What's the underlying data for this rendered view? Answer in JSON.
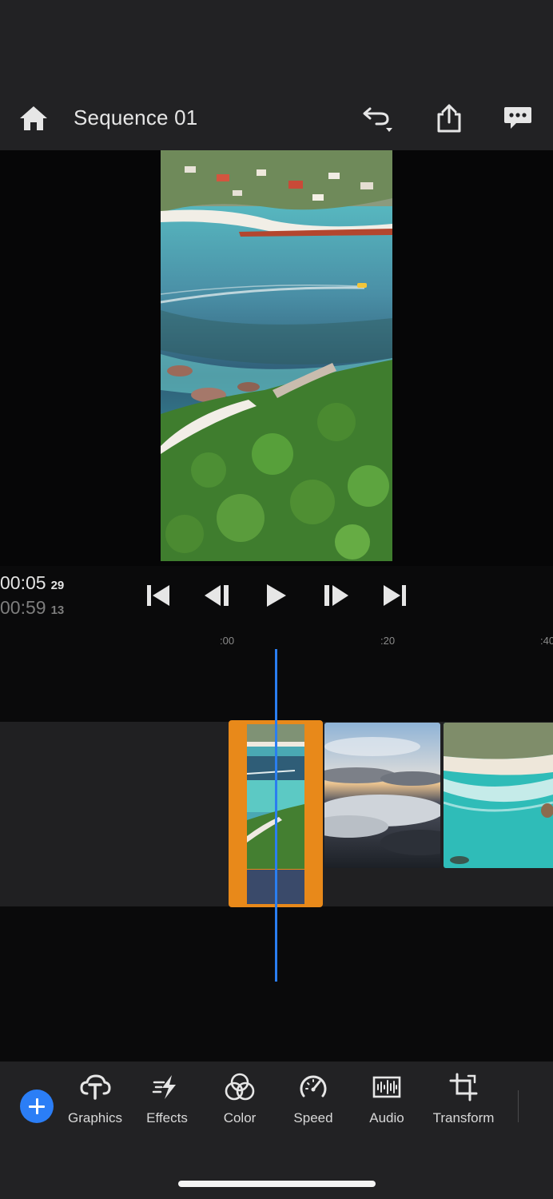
{
  "header": {
    "title": "Sequence 01",
    "icons": [
      "home-icon",
      "undo-icon",
      "share-icon",
      "comments-icon"
    ]
  },
  "playback": {
    "current_time": "00:05",
    "current_frames": "29",
    "total_time": "00:59",
    "total_frames": "13",
    "controls": [
      "skip-to-start-icon",
      "step-back-icon",
      "play-icon",
      "step-forward-icon",
      "skip-to-end-icon"
    ]
  },
  "ruler": {
    "ticks": [
      ":00",
      ":20",
      ":40"
    ]
  },
  "timeline": {
    "clips": [
      "coastline-boat-clip",
      "clouds-sunset-clip",
      "beach-waves-clip"
    ],
    "selected_clip_color": "#e8891a",
    "playhead_color": "#2a7ef0"
  },
  "toolbar": {
    "add_icon": "plus-icon",
    "tools": [
      {
        "label": "Graphics",
        "icon": "graphics-icon"
      },
      {
        "label": "Effects",
        "icon": "effects-icon"
      },
      {
        "label": "Color",
        "icon": "color-icon"
      },
      {
        "label": "Speed",
        "icon": "speed-icon"
      },
      {
        "label": "Audio",
        "icon": "audio-icon"
      },
      {
        "label": "Transform",
        "icon": "transform-icon"
      }
    ]
  }
}
